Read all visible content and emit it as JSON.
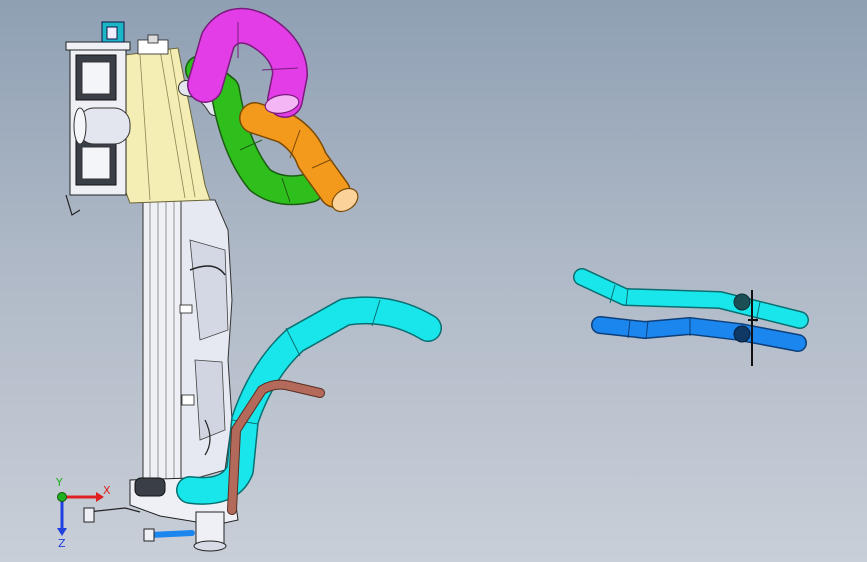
{
  "viewport": {
    "background_top": "#8fa0b4",
    "background_bottom": "#c9cfd8"
  },
  "colors": {
    "magenta_hose": "#e23de6",
    "orange_hose": "#f39a1c",
    "green_hose": "#2fbf1d",
    "cyan_hose": "#19e6ea",
    "blue_hose": "#1c86ef",
    "copper_pipe": "#b46a5a",
    "tank_beige": "#f4eeb4",
    "metal_light": "#eef0f6",
    "metal_dark": "#3a3f47"
  },
  "triad": {
    "x_label": "X",
    "y_label": "Y",
    "z_label": "Z",
    "x_color": "#e02020",
    "y_color": "#20b020",
    "z_color": "#2040e0"
  }
}
